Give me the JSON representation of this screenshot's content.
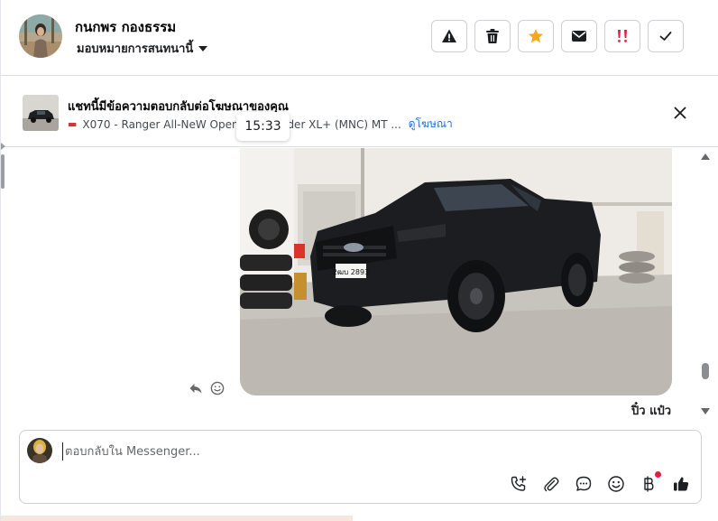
{
  "header": {
    "contact_name": "กนกพร กองธรรม",
    "assign_label": "มอบหมายการสนทนานี้",
    "actions": [
      {
        "name": "warning-icon",
        "color": "#1c1e21"
      },
      {
        "name": "trash-icon",
        "color": "#1c1e21"
      },
      {
        "name": "star-icon",
        "color": "#f5a623"
      },
      {
        "name": "envelope-icon",
        "color": "#1c1e21"
      },
      {
        "name": "exclamation-icon",
        "color": "#e41e3f"
      },
      {
        "name": "check-icon",
        "color": "#1c1e21"
      }
    ]
  },
  "ad_banner": {
    "title": "แชทนี้มีข้อความตอบกลับต่อโฆษณาของคุณ",
    "ad_text_left": "X070 - Ranger All-NeW Open C",
    "ad_text_right": "Rider XL+ (MNC) MT ...",
    "view_ad_link": "ดูโฆษณา"
  },
  "tooltip": {
    "timestamp": "15:33"
  },
  "messages": {
    "sender_name": "ปิ๋ว แป๋ว",
    "plate_text": "2ฒบ 2893"
  },
  "composer": {
    "placeholder": "ตอบกลับใน Messenger...",
    "tools": [
      "phone-plus-icon",
      "paperclip-icon",
      "chat-bubble-icon",
      "smiley-icon",
      "baht-icon",
      "thumbs-up-icon"
    ]
  },
  "colors": {
    "link": "#216fdb",
    "star": "#f5a623",
    "alert": "#e41e3f",
    "border": "#ccd0d5"
  }
}
